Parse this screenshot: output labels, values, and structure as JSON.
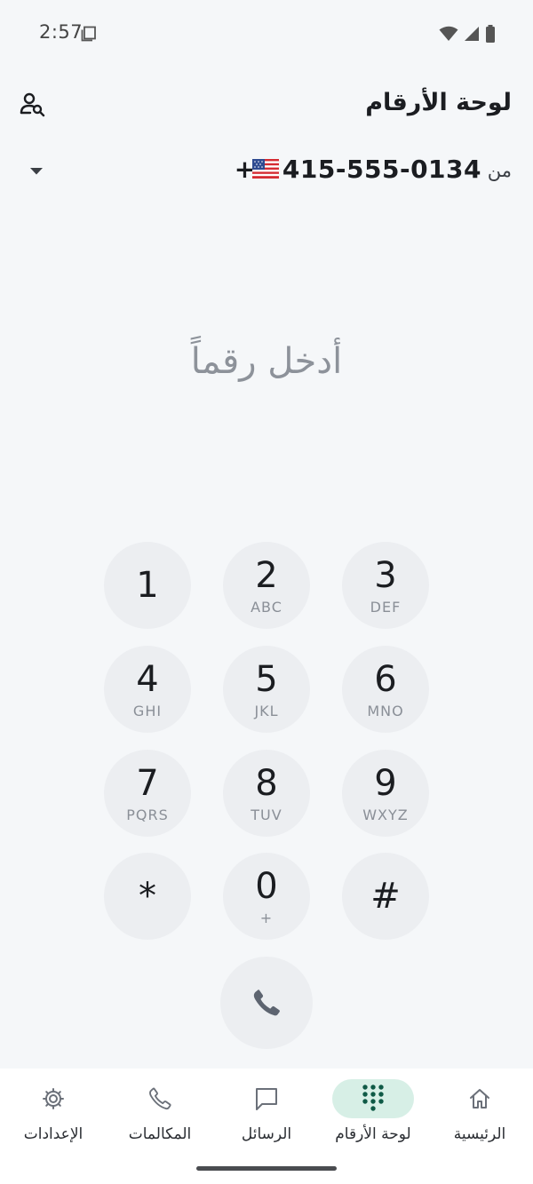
{
  "status_bar": {
    "time": "2:57"
  },
  "header": {
    "title": "لوحة الأرقام"
  },
  "from_row": {
    "label": "من",
    "number": "+1 415-555-0134"
  },
  "display": {
    "placeholder": "أدخل رقماً"
  },
  "keypad": {
    "keys": [
      {
        "digit": "1",
        "letters": ""
      },
      {
        "digit": "2",
        "letters": "ABC"
      },
      {
        "digit": "3",
        "letters": "DEF"
      },
      {
        "digit": "4",
        "letters": "GHI"
      },
      {
        "digit": "5",
        "letters": "JKL"
      },
      {
        "digit": "6",
        "letters": "MNO"
      },
      {
        "digit": "7",
        "letters": "PQRS"
      },
      {
        "digit": "8",
        "letters": "TUV"
      },
      {
        "digit": "9",
        "letters": "WXYZ"
      },
      {
        "digit": "*",
        "letters": ""
      },
      {
        "digit": "0",
        "letters": "+"
      },
      {
        "digit": "#",
        "letters": ""
      }
    ]
  },
  "bottom_nav": {
    "items": [
      {
        "label": "الرئيسية",
        "icon": "home-icon"
      },
      {
        "label": "لوحة الأرقام",
        "icon": "dialpad-icon",
        "active": true
      },
      {
        "label": "الرسائل",
        "icon": "message-icon"
      },
      {
        "label": "المكالمات",
        "icon": "phone-icon"
      },
      {
        "label": "الإعدادات",
        "icon": "gear-icon"
      }
    ]
  },
  "colors": {
    "background": "#f5f7f9",
    "key_bg": "#eceef1",
    "active_pill": "#d7efe6",
    "accent": "#0f5a46"
  }
}
